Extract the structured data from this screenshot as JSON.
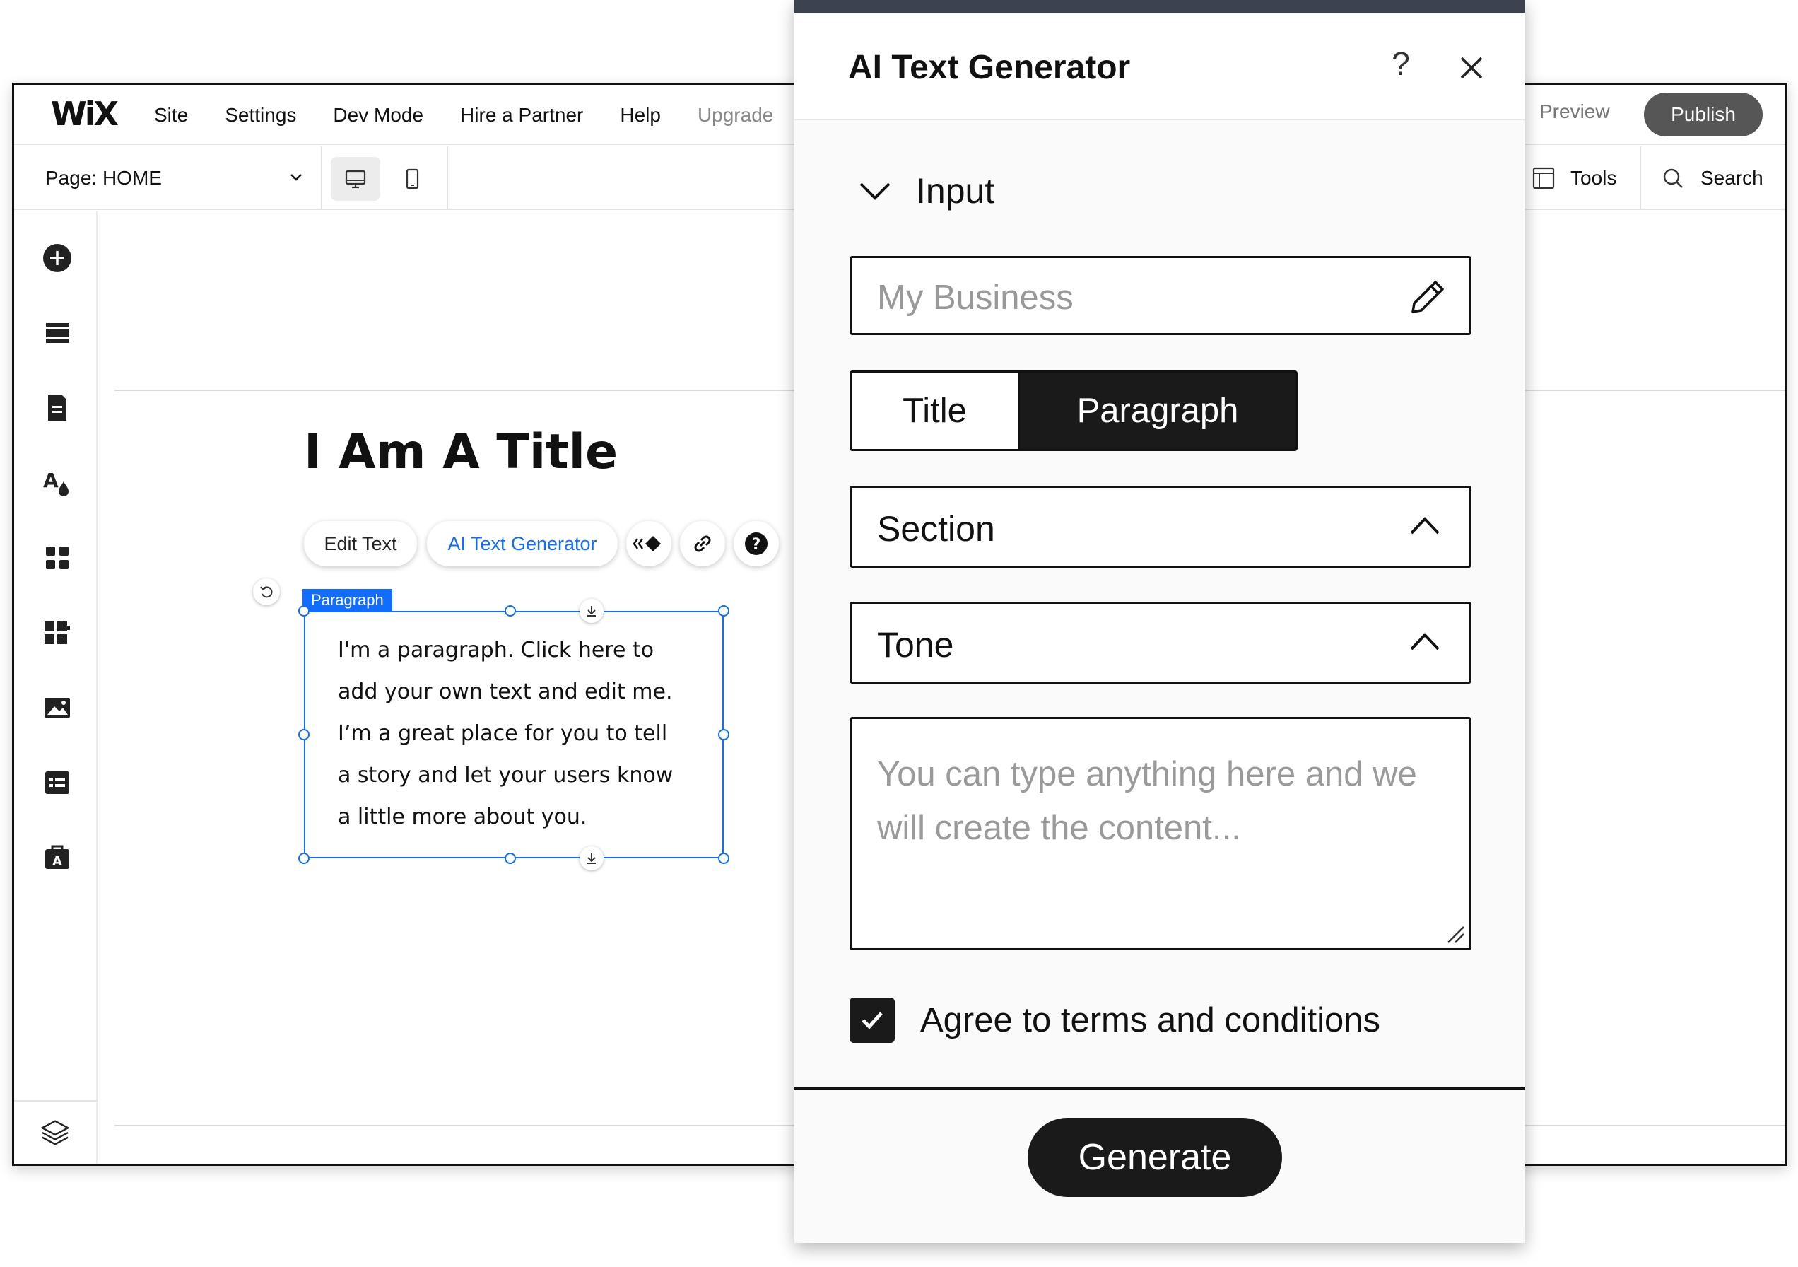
{
  "colors": {
    "accent": "#116dff",
    "dark": "#1a1a1a",
    "publish_bg": "#565656",
    "panel_strip": "#3d4250"
  },
  "topbar": {
    "logo": "WiX",
    "menu": [
      "Site",
      "Settings",
      "Dev Mode",
      "Hire a Partner",
      "Help",
      "Upgrade"
    ],
    "preview_label": "Preview",
    "publish_label": "Publish"
  },
  "toolbar": {
    "page_prefix": "Page:",
    "page_name": "HOME",
    "tools_label": "Tools",
    "search_label": "Search"
  },
  "leftbar": {
    "icons": [
      "add-icon",
      "sections-icon",
      "pages-icon",
      "theme-icon",
      "apps-icon",
      "business-icon",
      "media-icon",
      "cms-icon",
      "portfolio-icon",
      "layers-icon"
    ]
  },
  "canvas": {
    "title": "I Am A Title",
    "context_bar": {
      "edit_text_label": "Edit Text",
      "ai_label": "AI Text Generator",
      "icons": [
        "animation-icon",
        "link-icon",
        "help-icon"
      ]
    },
    "selection_label": "Paragraph",
    "paragraph_lines": [
      "I'm a paragraph. Click here to",
      "add your own text and edit me.",
      "I’m a great place for you to tell",
      "a story and let your users know",
      "a little more about you."
    ]
  },
  "panel": {
    "title": "AI Text Generator",
    "help_glyph": "?",
    "section_label": "Input",
    "business_placeholder": "My Business",
    "type_options": {
      "title": "Title",
      "paragraph": "Paragraph",
      "selected": "Paragraph"
    },
    "section_dropdown": "Section",
    "tone_dropdown": "Tone",
    "prompt_placeholder": "You can type anything here and we will create the content...",
    "agree_label": "Agree to terms and conditions",
    "agree_checked": true,
    "generate_label": "Generate"
  }
}
